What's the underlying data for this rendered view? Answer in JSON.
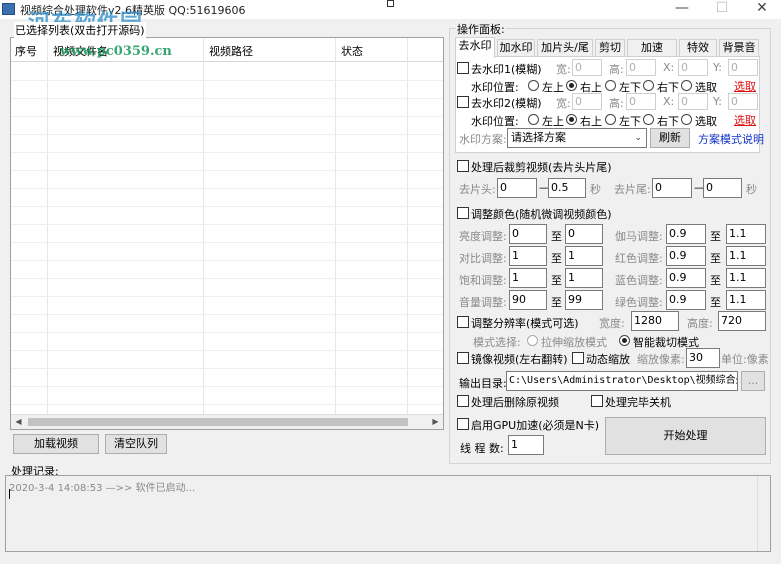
{
  "window": {
    "title": "视频综合处理软件v2.6精英版  QQ:51619606",
    "minimize": "—",
    "maximize": "☐",
    "close": "✕"
  },
  "watermark": {
    "logo": "河东软件园",
    "url": "www.pc0359.cn"
  },
  "selected_items": "已选择列表(双击打开源码)",
  "list": {
    "columns": [
      "序号",
      "视频文件名",
      "视频路径",
      "状态"
    ]
  },
  "buttons": {
    "load": "加载视频",
    "clear": "清空队列",
    "refresh": "刷新",
    "start": "开始处理",
    "browse": "..."
  },
  "panel": {
    "title": "操作面板:",
    "tabs": [
      "去水印",
      "加水印",
      "加片头/尾",
      "剪切",
      "加速",
      "特效",
      "背景音"
    ],
    "active_tab": "去水印"
  },
  "wm1": {
    "label": "去水印1(模糊)",
    "w_label": "宽:",
    "w": "0",
    "h_label": "高:",
    "h": "0",
    "x_label": "X:",
    "x": "0",
    "y_label": "Y:",
    "y": "0",
    "pos_label": "水印位置:",
    "positions": [
      "左上",
      "右上",
      "左下",
      "右下",
      "选取"
    ],
    "pick_link": "选取"
  },
  "wm2": {
    "label": "去水印2(模糊)",
    "w_label": "宽:",
    "w": "0",
    "h_label": "高:",
    "h": "0",
    "x_label": "X:",
    "x": "0",
    "y_label": "Y:",
    "y": "0",
    "pos_label": "水印位置:",
    "positions": [
      "左上",
      "右上",
      "左下",
      "右下",
      "选取"
    ],
    "pick_link": "选取"
  },
  "scheme": {
    "label": "水印方案:",
    "value": "请选择方案",
    "help": "方案模式说明"
  },
  "trim": {
    "label": "处理后裁剪视频(去片头片尾)",
    "head_label": "去片头:",
    "head_from": "0",
    "head_to": "0.5",
    "tail_label": "去片尾:",
    "tail_from": "0",
    "tail_to": "0",
    "dash": "—",
    "unit": "秒"
  },
  "color": {
    "label": "调整颜色(随机微调视频颜色)",
    "to": "至",
    "rows": [
      {
        "l_label": "亮度调整:",
        "l_from": "0",
        "l_to": "0",
        "r_label": "伽马调整:",
        "r_from": "0.9",
        "r_to": "1.1"
      },
      {
        "l_label": "对比调整:",
        "l_from": "1",
        "l_to": "1",
        "r_label": "红色调整:",
        "r_from": "0.9",
        "r_to": "1.1"
      },
      {
        "l_label": "饱和调整:",
        "l_from": "1",
        "l_to": "1",
        "r_label": "蓝色调整:",
        "r_from": "0.9",
        "r_to": "1.1"
      },
      {
        "l_label": "音量调整:",
        "l_from": "90",
        "l_to": "99",
        "r_label": "绿色调整:",
        "r_from": "0.9",
        "r_to": "1.1"
      }
    ]
  },
  "resolution": {
    "label": "调整分辨率(模式可选)",
    "w_label": "宽度:",
    "w": "1280",
    "h_label": "高度:",
    "h": "720",
    "mode_label": "模式选择:",
    "mode_stretch": "拉伸缩放模式",
    "mode_crop": "智能裁切模式"
  },
  "mirror": {
    "label": "镜像视频(左右翻转)"
  },
  "dynzoom": {
    "label": "动态缩放",
    "px_label": "缩放像素:",
    "px": "30",
    "unit": "单位:像素"
  },
  "output": {
    "label": "输出目录:",
    "path": "C:\\Users\\Administrator\\Desktop\\视频综合处理软件"
  },
  "delete_src": {
    "label": "处理后删除原视频"
  },
  "shutdown": {
    "label": "处理完毕关机"
  },
  "gpu": {
    "label": "启用GPU加速(必须是N卡)"
  },
  "threads": {
    "label": "线 程 数:",
    "value": "1"
  },
  "log": {
    "title": "处理记录:",
    "line": "2020-3-4  14:08:53 —>> 软件已启动..."
  }
}
